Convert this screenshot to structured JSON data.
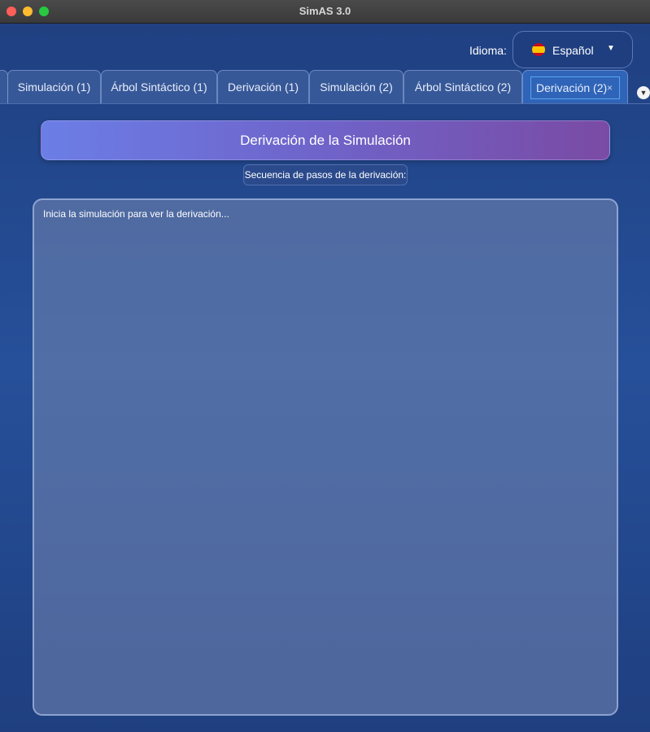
{
  "window": {
    "title": "SimAS 3.0"
  },
  "language": {
    "label": "Idioma:",
    "selected": "Español",
    "flag_icon": "spain-flag-icon"
  },
  "tabs": [
    {
      "label": "Simulación (1)",
      "active": false
    },
    {
      "label": "Árbol Sintáctico (1)",
      "active": false
    },
    {
      "label": "Derivación (1)",
      "active": false
    },
    {
      "label": "Simulación (2)",
      "active": false
    },
    {
      "label": "Árbol Sintáctico (2)",
      "active": false
    },
    {
      "label": "Derivación (2)",
      "active": true,
      "closable": true
    }
  ],
  "tab_close_glyph": "×",
  "content": {
    "header": "Derivación de la Simulación",
    "subtitle": "Secuencia de pasos de la derivación:",
    "placeholder": "Inicia la simulación para ver la derivación..."
  },
  "colors": {
    "accent_start": "#6b7ee6",
    "accent_end": "#7a4ba4",
    "background": "#26509a"
  }
}
